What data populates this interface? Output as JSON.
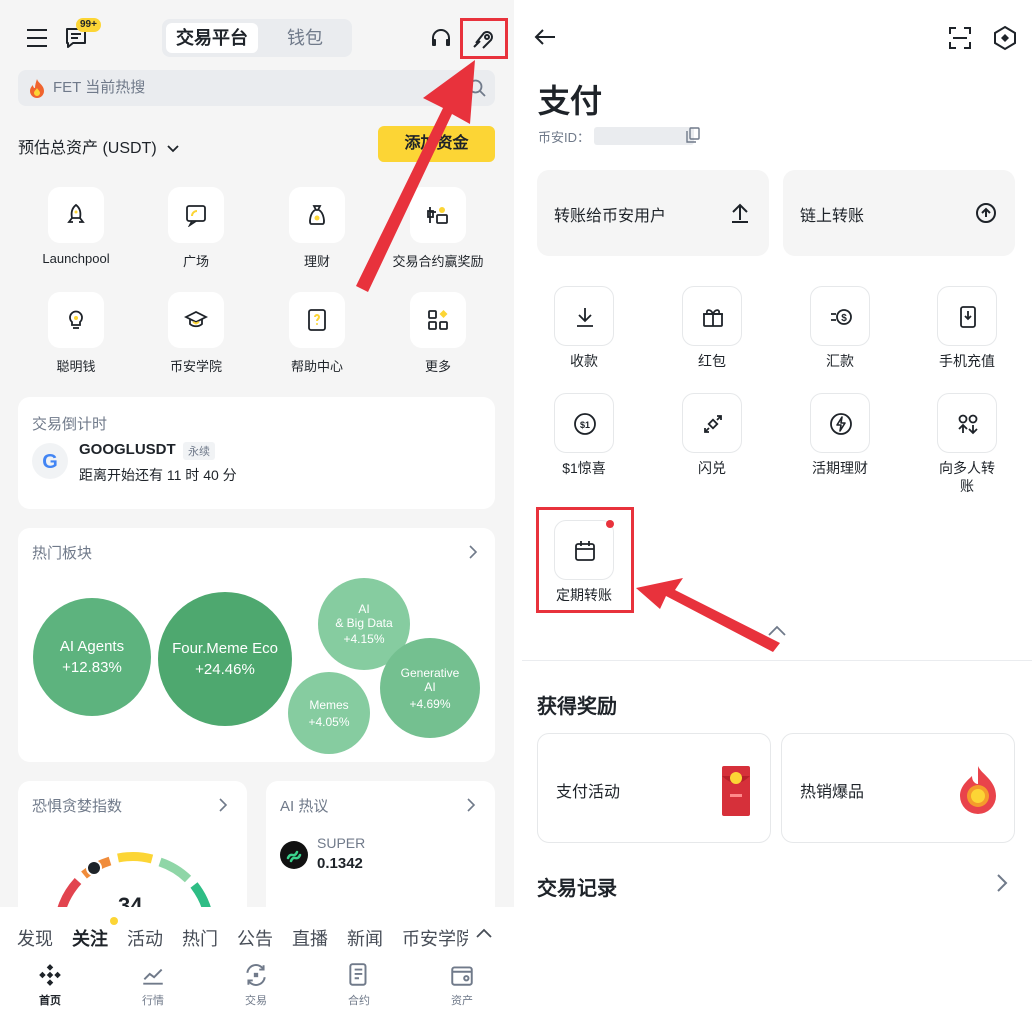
{
  "left": {
    "tabs": {
      "active": "交易平台",
      "other": "钱包"
    },
    "notification_badge": "99+",
    "search_placeholder": "FET 当前热搜",
    "assets_label": "预估总资产 (USDT)",
    "add_funds": "添加资金",
    "quick_actions": [
      {
        "label": "Launchpool",
        "icon": "rocket-icon"
      },
      {
        "label": "广场",
        "icon": "square-chat-icon"
      },
      {
        "label": "理财",
        "icon": "money-bag-icon"
      },
      {
        "label": "交易合约赢奖励",
        "icon": "gift-trade-icon"
      },
      {
        "label": "聪明钱",
        "icon": "lightbulb-icon"
      },
      {
        "label": "币安学院",
        "icon": "graduation-cap-icon"
      },
      {
        "label": "帮助中心",
        "icon": "help-book-icon"
      },
      {
        "label": "更多",
        "icon": "more-grid-icon"
      }
    ],
    "countdown": {
      "title": "交易倒计时",
      "symbol": "GOOGLUSDT",
      "tag": "永续",
      "text": "距离开始还有 11 时 40 分"
    },
    "hot_sectors": {
      "title": "热门板块",
      "items": [
        {
          "name": "AI Agents",
          "change": "+12.83%"
        },
        {
          "name": "Four.Meme Eco",
          "change": "+24.46%"
        },
        {
          "name": "AI & Big Data",
          "line1": "AI",
          "line2": "& Big Data",
          "change": "+4.15%"
        },
        {
          "name": "Memes",
          "change": "+4.05%"
        },
        {
          "name": "Generative AI",
          "line1": "Generative",
          "line2": "AI",
          "change": "+4.69%"
        }
      ]
    },
    "fear_greed": {
      "title": "恐惧贪婪指数",
      "value": "34"
    },
    "ai_hot": {
      "title": "AI 热议",
      "symbol": "SUPER",
      "price": "0.1342"
    },
    "feed_tabs": [
      "发现",
      "关注",
      "活动",
      "热门",
      "公告",
      "直播",
      "新闻",
      "币安学院"
    ],
    "nav": [
      {
        "label": "首页",
        "icon": "binance-logo-icon"
      },
      {
        "label": "行情",
        "icon": "chart-icon"
      },
      {
        "label": "交易",
        "icon": "trade-icon"
      },
      {
        "label": "合约",
        "icon": "futures-icon"
      },
      {
        "label": "资产",
        "icon": "wallet-icon"
      }
    ]
  },
  "right": {
    "title": "支付",
    "id_label": "币安ID：",
    "transfer_user": "转账给币安用户",
    "onchain": "链上转账",
    "actions": [
      {
        "label": "收款",
        "icon": "download-icon"
      },
      {
        "label": "红包",
        "icon": "gift-icon"
      },
      {
        "label": "汇款",
        "icon": "remit-icon"
      },
      {
        "label": "手机充值",
        "icon": "phone-topup-icon"
      },
      {
        "label": "$1惊喜",
        "icon": "dollar-coin-icon"
      },
      {
        "label": "闪兑",
        "icon": "convert-icon"
      },
      {
        "label": "活期理财",
        "icon": "flash-earn-icon"
      },
      {
        "label": "向多人转账",
        "line1": "向多人转",
        "line2": "账",
        "icon": "multi-transfer-icon"
      },
      {
        "label": "定期转账",
        "icon": "calendar-icon"
      }
    ],
    "rewards_title": "获得奖励",
    "rewards": [
      {
        "label": "支付活动"
      },
      {
        "label": "热销爆品"
      }
    ],
    "history_title": "交易记录"
  },
  "colors": {
    "brand_yellow": "#FCD535",
    "bubble_green": "#5DB37E",
    "highlight_red": "#E8323C"
  }
}
